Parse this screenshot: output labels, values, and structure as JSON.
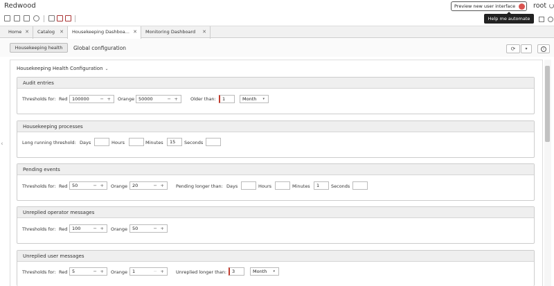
{
  "app": {
    "brand": "Redwood",
    "preview_button": "Preview new user interface",
    "user": "root",
    "help_automate": "Help me automate"
  },
  "tabs": [
    {
      "label": "Home"
    },
    {
      "label": "Catalog"
    },
    {
      "label": "Housekeeping Dashboa..."
    },
    {
      "label": "Monitoring Dashboard"
    }
  ],
  "subbar": {
    "housekeeping_health": "Housekeeping health",
    "global_configuration": "Global configuration"
  },
  "config_title": "Housekeeping Health Configuration",
  "labels": {
    "thresholds_for": "Thresholds for:",
    "red": "Red",
    "orange": "Orange",
    "days": "Days",
    "hours": "Hours",
    "minutes": "Minutes",
    "seconds": "Seconds",
    "minus": "−",
    "plus": "+"
  },
  "sections": {
    "audit": {
      "title": "Audit entries",
      "red": "100000",
      "orange": "50000",
      "older_than_label": "Older than:",
      "older_value": "1",
      "older_unit": "Month"
    },
    "processes": {
      "title": "Housekeeping processes",
      "long_running_label": "Long running threshold:",
      "days": "",
      "hours": "",
      "minutes": "15",
      "seconds": ""
    },
    "pending": {
      "title": "Pending events",
      "red": "50",
      "orange": "20",
      "pending_longer_label": "Pending longer than:",
      "days": "",
      "hours": "",
      "minutes": "1",
      "seconds": ""
    },
    "operator": {
      "title": "Unreplied operator messages",
      "red": "100",
      "orange": "50"
    },
    "user": {
      "title": "Unreplied user messages",
      "red": "5",
      "orange": "1",
      "unreplied_longer_label": "Unreplied longer than:",
      "longer_value": "3",
      "longer_unit": "Month"
    }
  }
}
